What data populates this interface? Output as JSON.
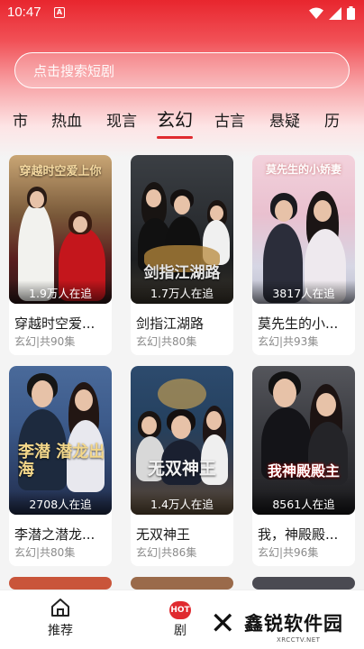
{
  "status": {
    "time": "10:47",
    "notif": "A"
  },
  "search": {
    "placeholder": "点击搜索短剧"
  },
  "tabs": [
    {
      "label": "市"
    },
    {
      "label": "热血"
    },
    {
      "label": "现言"
    },
    {
      "label": "玄幻",
      "active": true
    },
    {
      "label": "古言"
    },
    {
      "label": "悬疑"
    },
    {
      "label": "历"
    }
  ],
  "cards": [
    {
      "title": "穿越时空爱...",
      "sub": "玄幻|共90集",
      "views": "1.9万人在追",
      "poster_text": "穿越时空爱上你"
    },
    {
      "title": "剑指江湖路",
      "sub": "玄幻|共80集",
      "views": "1.7万人在追",
      "poster_text": "剑指江湖路"
    },
    {
      "title": "莫先生的小...",
      "sub": "玄幻|共93集",
      "views": "3817人在追",
      "poster_text": "莫先生的小娇妻"
    },
    {
      "title": "李潜之潜龙...",
      "sub": "玄幻|共80集",
      "views": "2708人在追",
      "poster_text": "李潜 潜龙出海"
    },
    {
      "title": "无双神王",
      "sub": "玄幻|共86集",
      "views": "1.4万人在追",
      "poster_text": "无双神王"
    },
    {
      "title": "我，神殿殿...",
      "sub": "玄幻|共96集",
      "views": "8561人在追",
      "poster_text": "我神殿殿主"
    }
  ],
  "nav": {
    "home_label": "推荐",
    "drama_label": "剧",
    "hot_badge": "HOT"
  },
  "watermark": {
    "brand": "鑫锐软件园",
    "url": "XRCCTV.NET"
  },
  "colors": {
    "accent": "#e02a2f",
    "header_red": "#e8262e"
  }
}
